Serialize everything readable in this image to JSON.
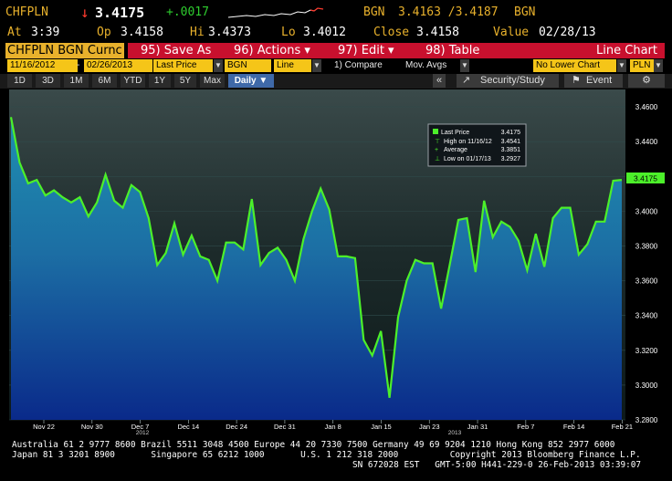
{
  "quote": {
    "ticker": "CHFPLN",
    "arrow": "↓",
    "last": "3.4175",
    "change": "+.0017",
    "source": "BGN",
    "bid_ask": "3.4163 /3.4187",
    "source2": "BGN",
    "at_label": "At",
    "at": "3:39",
    "op_label": "Op",
    "op": "3.4158",
    "hi_label": "Hi",
    "hi": "3.4373",
    "lo_label": "Lo",
    "lo": "3.4012",
    "close_label": "Close",
    "close": "3.4158",
    "value_label": "Value",
    "value": "02/28/13"
  },
  "toolbar": {
    "ticker_tab": "CHFPLN BGN Curnc",
    "save_as": "95) Save As",
    "actions": "96) Actions ▾",
    "edit": "97) Edit ▾",
    "table": "98) Table",
    "chart_type": "Line Chart"
  },
  "controls": {
    "start_date": "11/16/2012",
    "end_date": "02/26/2013",
    "field": "Last Price",
    "source": "BGN",
    "style": "Line",
    "compare": "1) Compare",
    "mov_avgs": "Mov. Avgs",
    "lower_chart": "No Lower Chart",
    "currency": "PLN"
  },
  "ranges": [
    "1D",
    "3D",
    "1M",
    "6M",
    "YTD",
    "1Y",
    "5Y",
    "Max"
  ],
  "range_selected": "Daily ▼",
  "security_study": "Security/Study",
  "event": "Event",
  "legend": {
    "last_price_label": "Last Price",
    "last_price": "3.4175",
    "high_label": "High on 11/16/12",
    "high": "3.4541",
    "avg_label": "Average",
    "avg": "3.3851",
    "low_label": "Low on 01/17/13",
    "low": "3.2927"
  },
  "chart_data": {
    "type": "area",
    "series_name": "Last Price",
    "ylim": [
      3.28,
      3.47
    ],
    "yticks": [
      "3.4600",
      "3.4400",
      "3.4200",
      "3.4000",
      "3.3800",
      "3.3600",
      "3.3400",
      "3.3200",
      "3.3000",
      "3.2800"
    ],
    "last_label": "3.4175",
    "xticks": [
      "Nov 22",
      "Nov 30",
      "Dec 7",
      "Dec 14",
      "Dec 24",
      "Dec 31",
      "Jan 8",
      "Jan 15",
      "Jan 23",
      "Jan 31",
      "Feb 7",
      "Feb 14",
      "Feb 21"
    ],
    "year_labels": [
      "2012",
      "2013"
    ],
    "values": [
      3.4541,
      3.428,
      3.416,
      3.418,
      3.409,
      3.412,
      3.408,
      3.405,
      3.408,
      3.397,
      3.405,
      3.421,
      3.406,
      3.402,
      3.415,
      3.411,
      3.396,
      3.369,
      3.376,
      3.393,
      3.375,
      3.386,
      3.374,
      3.372,
      3.36,
      3.382,
      3.382,
      3.378,
      3.407,
      3.369,
      3.376,
      3.379,
      3.372,
      3.36,
      3.384,
      3.4,
      3.413,
      3.401,
      3.374,
      3.374,
      3.373,
      3.326,
      3.317,
      3.331,
      3.2927,
      3.339,
      3.36,
      3.372,
      3.37,
      3.37,
      3.344,
      3.369,
      3.395,
      3.396,
      3.365,
      3.406,
      3.385,
      3.394,
      3.391,
      3.383,
      3.366,
      3.387,
      3.368,
      3.396,
      3.402,
      3.402,
      3.375,
      3.381,
      3.394,
      3.394,
      3.4175,
      3.418
    ]
  },
  "footer": {
    "line1": "Australia 61 2 9777 8600 Brazil 5511 3048 4500 Europe 44 20 7330 7500 Germany 49 69 9204 1210 Hong Kong 852 2977 6000",
    "line2": "Japan 81 3 3201 8900       Singapore 65 6212 1000       U.S. 1 212 318 2000          Copyright 2013 Bloomberg Finance L.P.",
    "line3": "SN 672028 EST   GMT-5:00 H441-229-0 26-Feb-2013 03:39:07"
  },
  "colors": {
    "amber": "#e8b12c",
    "red_bar": "#c8102e",
    "line": "#4cf02a",
    "input": "#f5c518"
  }
}
